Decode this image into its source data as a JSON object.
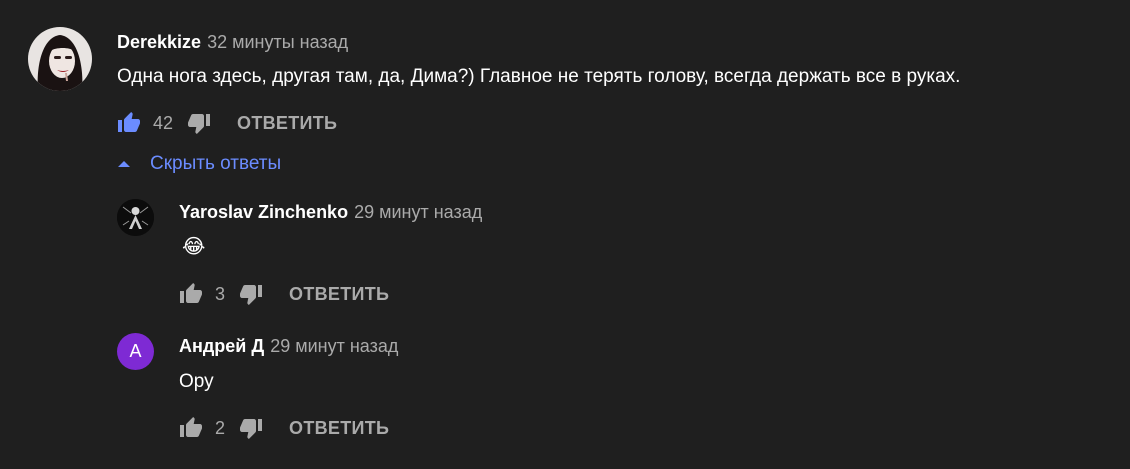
{
  "comment": {
    "author": "Derekkize",
    "time": "32 минуты назад",
    "text": "Одна нога здесь, другая там, да, Дима?) Главное не терять голову, всегда держать все в руках.",
    "likes": "42",
    "reply_label": "ОТВЕТИТЬ"
  },
  "toggle_replies": {
    "label": "Скрыть ответы",
    "icon": "triangle-up-icon"
  },
  "replies": [
    {
      "author": "Yaroslav Zinchenko",
      "time": "29 минут назад",
      "text": "😂",
      "likes": "3",
      "reply_label": "ОТВЕТИТЬ"
    },
    {
      "author": "Андрей Д",
      "time": "29 минут назад",
      "text": "Ору",
      "likes": "2",
      "reply_label": "ОТВЕТИТЬ",
      "avatar_letter": "А",
      "avatar_color": "#7e2ad4"
    }
  ],
  "colors": {
    "background": "#1f1f1f",
    "like_active": "#6b8cff",
    "secondary_text": "#aaaaaa",
    "link": "#6b8cff"
  }
}
